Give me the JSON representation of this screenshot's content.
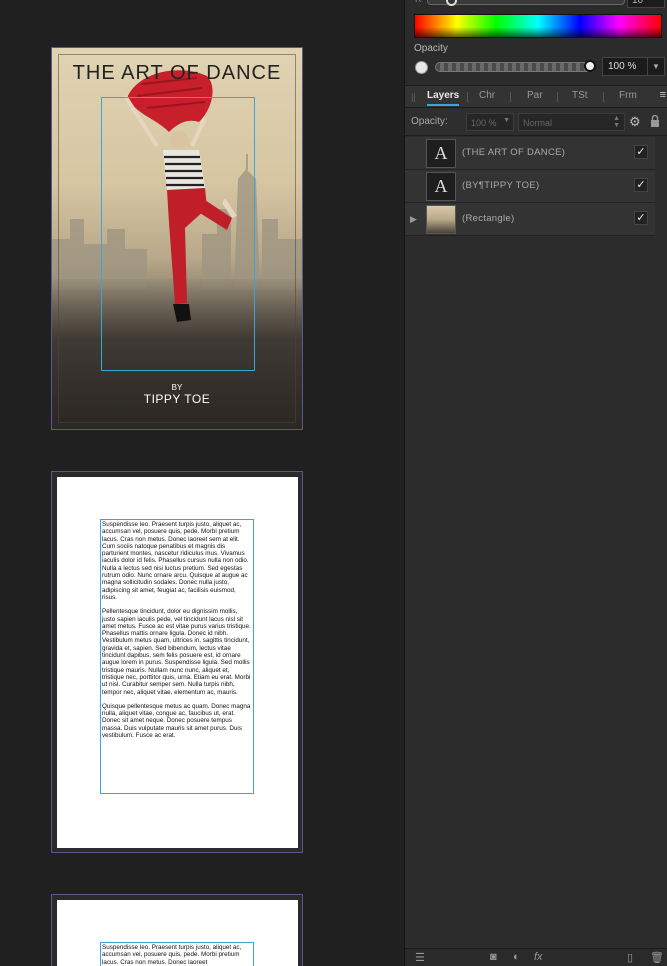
{
  "cover": {
    "title": "THE ART OF DANCE",
    "by": "BY",
    "author": "TIPPY TOE"
  },
  "page2": {
    "paragraphs": [
      "Suspendisse leo. Praesent turpis justo, aliquet ac, accumsan vel, posuere quis, pede. Morbi pretium lacus. Cras non metus. Donec laoreet sem at elit. Cum sociis natoque penatibus et magnis dis parturient montes, nascetur ridiculus mus. Vivamus iaculis dolor id felis. Phasellus cursus nulla non odio. Nulla a lectus sed nisi luctus pretium. Sed egestas rutrum odio. Nunc ornare arcu. Quisque at augue ac magna sollicitudin sodales. Donec nulla justo, adipiscing sit amet, feugiat ac, facilisis euismod, risus.",
      "Pellentesque tincidunt, dolor eu dignissim mollis, justo sapien iaculis pede, vel tincidunt lacus nisl sit amet metus. Fusce ac est vitae purus varius tristique. Phasellus mattis ornare ligula. Donec id nibh. Vestibulum metus quam, ultrices in, sagittis tincidunt, gravida et, sapien. Sed bibendum, lectus vitae tincidunt dapibus, sem felis posuere est, id ornare augue lorem in purus. Suspendisse ligula. Sed mollis tristique mauris. Nullam nunc nunc, aliquet et, tristique nec, porttitor quis, urna. Etiam eu erat. Morbi ut nisl. Curabitur semper sem. Nulla turpis nibh, tempor nec, aliquet vitae, elementum ac, mauris.",
      "Quisque pellentesque metus ac quam. Donec magna nulla, aliquet vitae, congue ac, faucibus ut, erat. Donec sit amet neque. Donec posuere tempus massa. Duis vulputate mauris sit amet purus. Duis vestibulum. Fusce ac erat."
    ]
  },
  "page3": {
    "paragraphs": [
      "Suspendisse leo. Praesent turpis justo, aliquet ac, accumsan vel, posuere quis, pede. Morbi pretium lacus. Cras non metus. Donec laoreet"
    ]
  },
  "color_panel": {
    "top_value": "10",
    "opacity_label": "Opacity",
    "opacity_value": "100 %",
    "opacity_level": 1.0
  },
  "tabs": [
    {
      "label": "Layers",
      "active": true
    },
    {
      "label": "Chr",
      "active": false
    },
    {
      "label": "Par",
      "active": false
    },
    {
      "label": "TSt",
      "active": false
    },
    {
      "label": "Frm",
      "active": false
    }
  ],
  "layer_options": {
    "opacity_label": "Opacity:",
    "opacity_value": "100 %",
    "blend_mode": "Normal"
  },
  "layers": [
    {
      "name": "(THE ART OF DANCE)",
      "thumb": "A",
      "type": "text",
      "visible": true
    },
    {
      "name": "(BY¶TIPPY TOE)",
      "thumb": "A",
      "type": "text",
      "visible": true
    },
    {
      "name": "(Rectangle)",
      "thumb": "",
      "type": "image",
      "visible": true,
      "expandable": true
    }
  ],
  "colors": {
    "selection": "#3aa5d8",
    "dancer_scarf": "#c8202a",
    "page_border": "#5a5a8a"
  }
}
